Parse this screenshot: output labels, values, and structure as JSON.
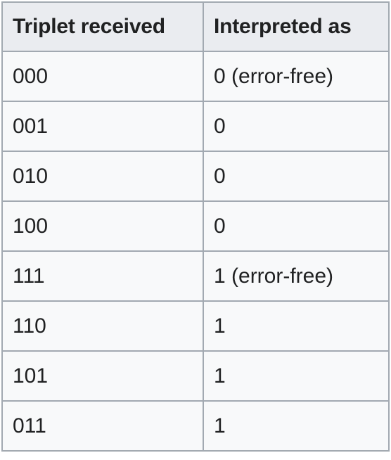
{
  "table": {
    "headers": [
      "Triplet received",
      "Interpreted as"
    ],
    "rows": [
      [
        "000",
        "0 (error-free)"
      ],
      [
        "001",
        "0"
      ],
      [
        "010",
        "0"
      ],
      [
        "100",
        "0"
      ],
      [
        "111",
        "1 (error-free)"
      ],
      [
        "110",
        "1"
      ],
      [
        "101",
        "1"
      ],
      [
        "011",
        "1"
      ]
    ]
  },
  "colors": {
    "border": "#a2a9b1",
    "header_bg": "#eaecf0",
    "cell_bg": "#f8f9fa",
    "text": "#202122"
  }
}
